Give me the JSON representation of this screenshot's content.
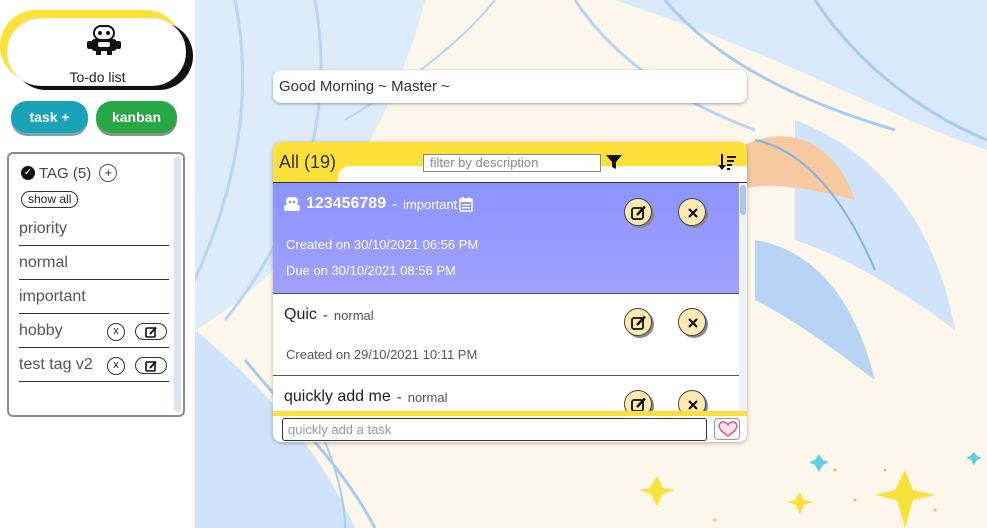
{
  "sidebar": {
    "app_title": "To-do list",
    "logo_icon": "robot-icon",
    "buttons": {
      "task": "task +",
      "kanban": "kanban"
    },
    "tags_header": {
      "label": "TAG (5)",
      "add": "+"
    },
    "show_all": "show all",
    "tags": [
      {
        "label": "priority",
        "editable": false
      },
      {
        "label": "normal",
        "editable": false
      },
      {
        "label": "important",
        "editable": false
      },
      {
        "label": "hobby",
        "editable": true,
        "remove": "x"
      },
      {
        "label": "test tag v2",
        "editable": true,
        "remove": "x"
      }
    ]
  },
  "greeting": "Good Morning ~ Master ~",
  "panel": {
    "title": "All (19)",
    "filter_placeholder": "filter by description",
    "quick_add_placeholder": "quickly add a task",
    "tasks": [
      {
        "title": "123456789",
        "sep": "-",
        "tag": "important",
        "created": "Created on 30/10/2021 06:56 PM",
        "due": "Due on 30/10/2021 08:56 PM",
        "selected": true
      },
      {
        "title": "Quic",
        "sep": "-",
        "tag": "normal",
        "created": "Created on 29/10/2021 10:11 PM"
      },
      {
        "title": "quickly add me",
        "sep": "-",
        "tag": "normal"
      }
    ]
  },
  "colors": {
    "accent_yellow": "#ffe03a",
    "task_button": "#1aa3b8",
    "kanban_button": "#28a745",
    "selected_task": "#8c94ff"
  }
}
